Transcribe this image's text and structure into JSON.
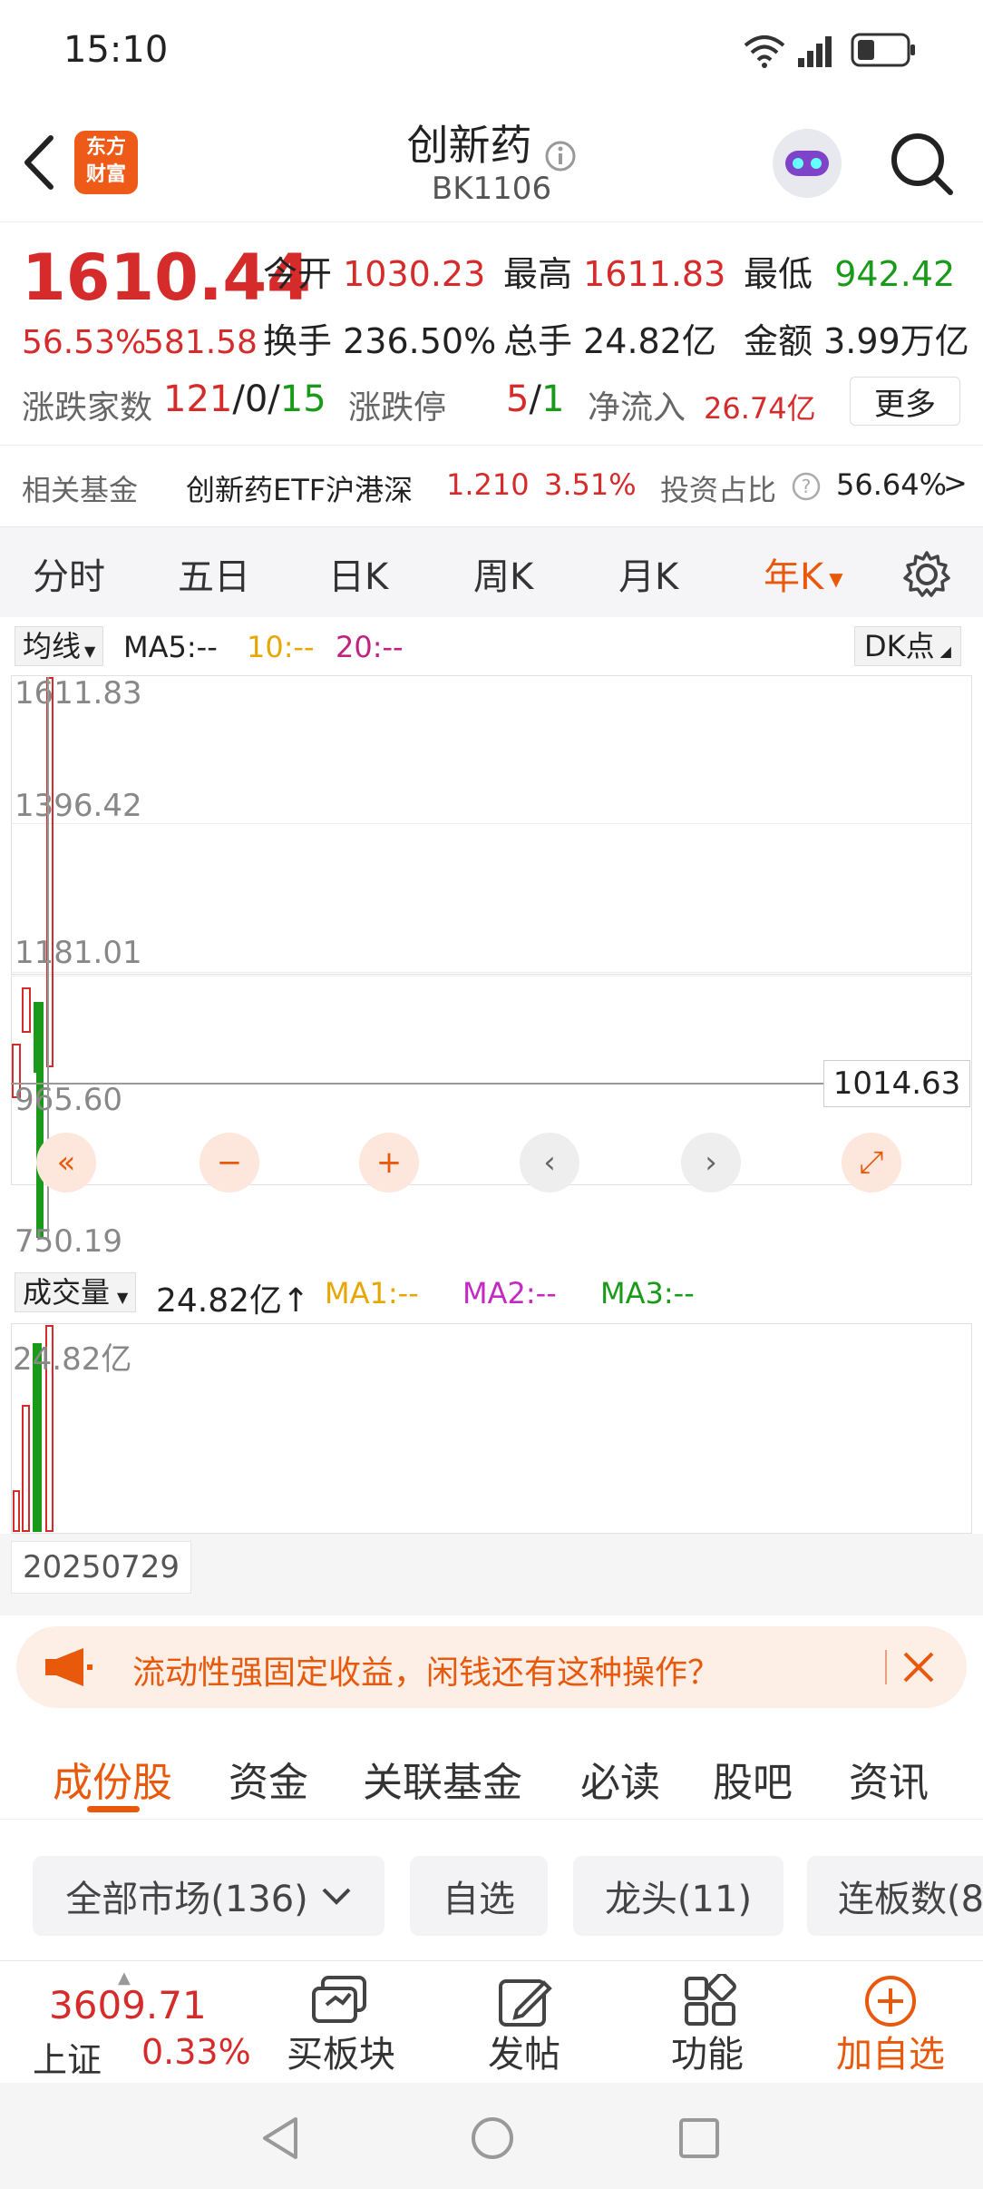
{
  "status": {
    "time": "15:10"
  },
  "header": {
    "logo_line1": "东方",
    "logo_line2": "财富",
    "title": "创新药",
    "code": "BK1106"
  },
  "quote": {
    "price": "1610.44",
    "change_pct": "56.53%",
    "change_amt": "581.58",
    "open_label": "今开",
    "open": "1030.23",
    "high_label": "最高",
    "high": "1611.83",
    "low_label": "最低",
    "low": "942.42",
    "turnover_label": "换手",
    "turnover": "236.50%",
    "volume_label": "总手",
    "volume": "24.82亿",
    "amount_label": "金额",
    "amount": "3.99万亿",
    "breadth_label": "涨跌家数",
    "up": "121",
    "flat": "0",
    "down": "15",
    "sep": "/",
    "limit_label": "涨跌停",
    "limit_up": "5",
    "limit_down": "1",
    "inflow_label": "净流入",
    "inflow": "26.74亿",
    "more_label": "更多"
  },
  "fund": {
    "label": "相关基金",
    "name": "创新药ETF沪港深",
    "price": "1.210",
    "pct": "3.51%",
    "ratio_label": "投资占比",
    "ratio": "56.64%",
    "arrow": ">"
  },
  "chart_tabs": [
    "分时",
    "五日",
    "日K",
    "周K",
    "月K",
    "年K"
  ],
  "active_chart_tab": "年K",
  "ma": {
    "select": "均线",
    "ma5": "MA5:--",
    "ma10": "10:--",
    "ma20": "20:--",
    "dk": "DK点"
  },
  "price_axis": [
    "1611.83",
    "1396.42",
    "1181.01",
    "965.60",
    "750.19"
  ],
  "crosshair_value": "1014.63",
  "volume": {
    "select": "成交量",
    "value": "24.82亿",
    "arrow": "↑",
    "ma1": "MA1:--",
    "ma2": "MA2:--",
    "ma3": "MA3:--",
    "axis_max": "24.82亿"
  },
  "date_label": "20250729",
  "ad": {
    "text": "流动性强固定收益，闲钱还有这种操作？"
  },
  "subtabs": [
    "成份股",
    "资金",
    "关联基金",
    "必读",
    "股吧",
    "资讯"
  ],
  "filters": [
    "全部市场(136)",
    "自选",
    "龙头(11)",
    "连板数(8"
  ],
  "bottom": {
    "index_value": "3609.71",
    "index_name": "上证",
    "index_pct": "0.33%",
    "buy_sector": "买板块",
    "post": "发帖",
    "func": "功能",
    "add": "加自选"
  },
  "colors": {
    "up": "#d62b2b",
    "down": "#1a9a1a",
    "accent": "#e8590c"
  }
}
